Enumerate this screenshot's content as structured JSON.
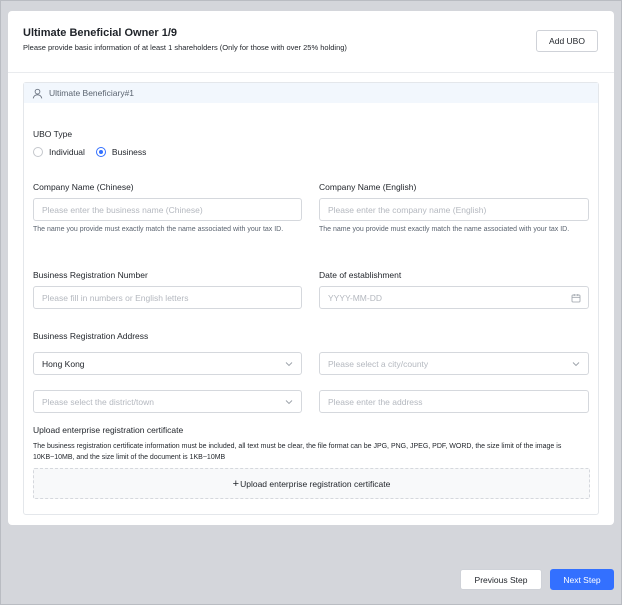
{
  "header": {
    "title": "Ultimate Beneficial Owner 1/9",
    "subtitle": "Please provide basic information of at least 1 shareholders (Only for those with over 25% holding)",
    "add_button": "Add UBO"
  },
  "ubo_section": {
    "heading": "Ultimate Beneficiary#1",
    "ubo_type_label": "UBO Type",
    "ubo_type_options": [
      "Individual",
      "Business"
    ],
    "ubo_type_selected": "Business",
    "company_name_cn": {
      "label": "Company Name (Chinese)",
      "placeholder": "Please enter the business name (Chinese)",
      "help": "The name you provide must exactly match the name associated with your tax ID."
    },
    "company_name_en": {
      "label": "Company Name (English)",
      "placeholder": "Please enter the company name (English)",
      "help": "The name you provide must exactly match the name associated with your tax ID."
    },
    "registration_number": {
      "label": "Business Registration Number",
      "placeholder": "Please fill in numbers or English letters"
    },
    "establishment_date": {
      "label": "Date of establishment",
      "placeholder": "YYYY-MM-DD"
    },
    "address": {
      "label": "Business Registration Address",
      "region_value": "Hong Kong",
      "city_placeholder": "Please select a city/county",
      "district_placeholder": "Please select the district/town",
      "address_placeholder": "Please enter the address"
    },
    "upload": {
      "label": "Upload enterprise registration certificate",
      "description": "The business registration certificate information must be included, all text must be clear, the file format can be JPG, PNG, JPEG, PDF, WORD, the size limit of the image is 10KB~10MB, and the size limit of the document is 1KB~10MB",
      "button_plus": "+",
      "button_label": "Upload enterprise registration certificate"
    }
  },
  "footer": {
    "previous": "Previous Step",
    "next": "Next Step"
  },
  "colors": {
    "primary": "#3370ff",
    "section_header_bg": "#f2f7fd",
    "page_bg": "#d4d6db"
  },
  "icons": {
    "section": "user-icon",
    "select": "chevron-down-icon",
    "date": "calendar-icon"
  }
}
